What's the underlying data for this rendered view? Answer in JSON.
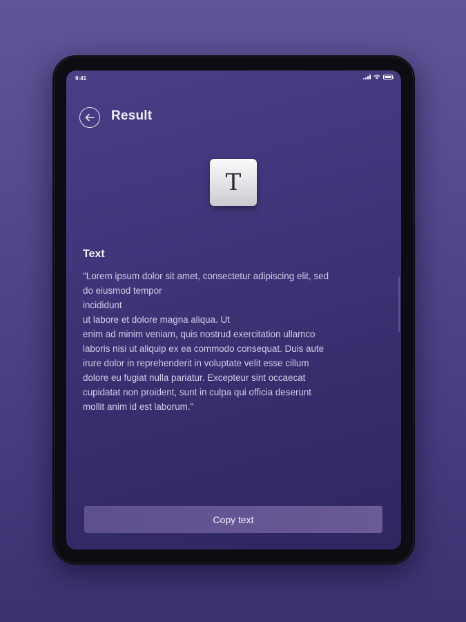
{
  "status_bar": {
    "time": "9:41",
    "icons": [
      "signal-icon",
      "wifi-icon",
      "battery-icon"
    ]
  },
  "header": {
    "back_icon": "arrow-left-icon",
    "title": "Result"
  },
  "type_tile": {
    "letter": "T",
    "icon": "text-type-icon"
  },
  "content": {
    "label": "Text",
    "body": "\"Lorem ipsum dolor sit amet, consectetur adipiscing elit, sed\ndo eiusmod tempor\nincididunt\nut labore et dolore magna aliqua. Ut\nenim ad minim veniam, quis nostrud exercitation ullamco\nlaboris nisi ut aliquip ex ea commodo consequat. Duis aute\nirure dolor in reprehenderit in voluptate velit esse cillum\ndolore eu fugiat nulla pariatur. Excepteur sint occaecat\ncupidatat non proident, sunt in culpa qui officia deserunt\nmollit anim id est laborum.\""
  },
  "actions": {
    "copy_label": "Copy text"
  },
  "colors": {
    "background": "#5f5597",
    "screen": "#3e3478",
    "button": "#64558f",
    "text_primary": "#f2f0fa",
    "text_secondary": "#d2cde8"
  }
}
